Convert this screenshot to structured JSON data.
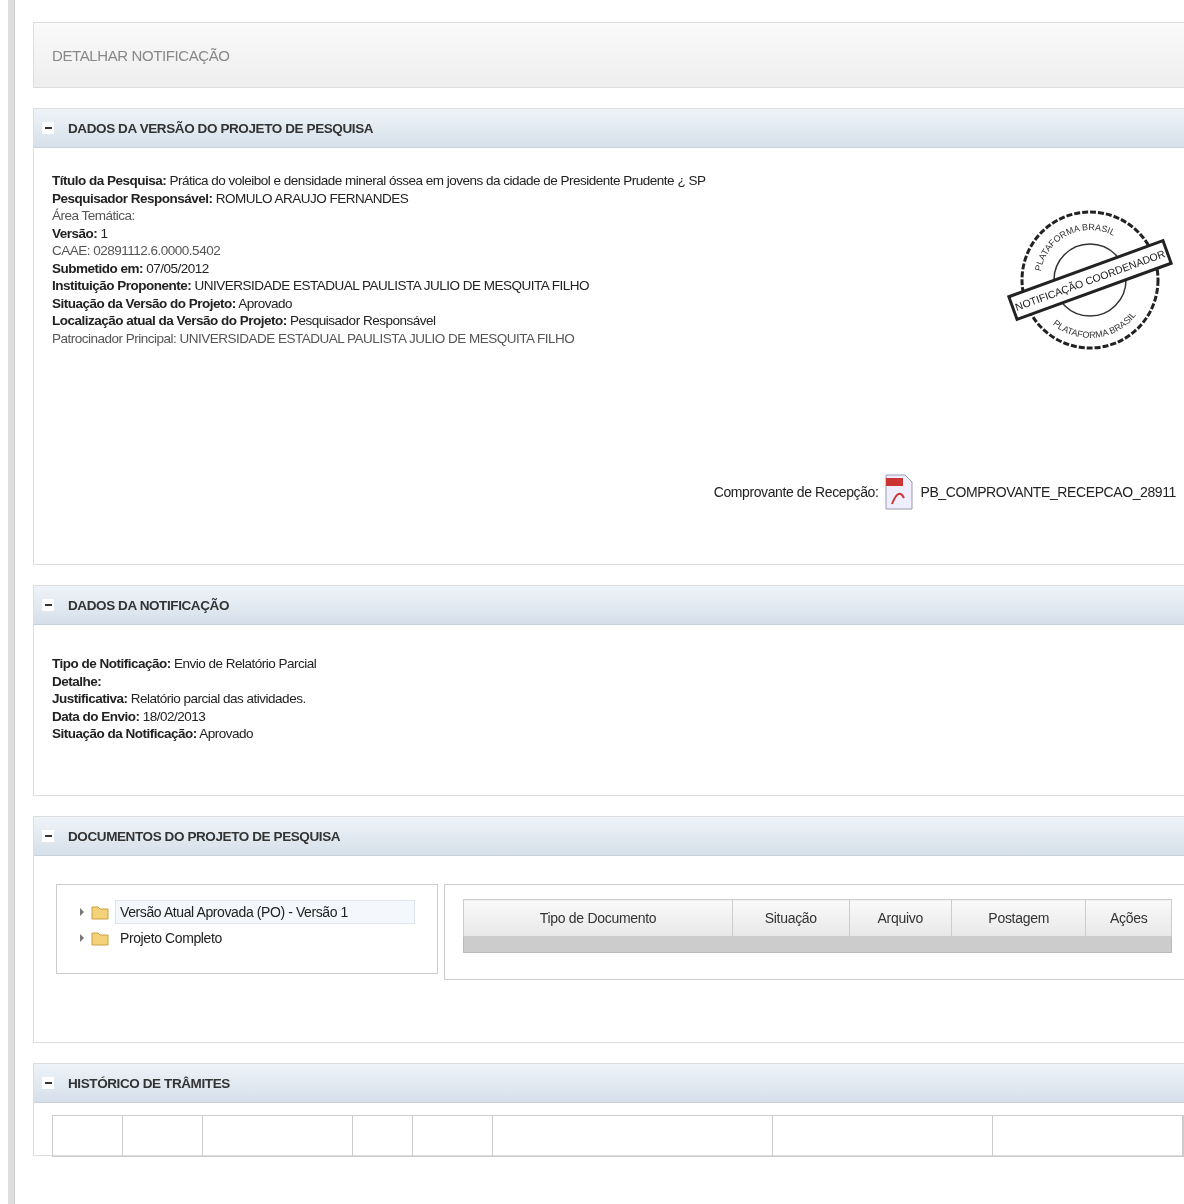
{
  "page_title": "DETALHAR NOTIFICAÇÃO",
  "project_section": {
    "title": "DADOS DA VERSÃO DO PROJETO DE PESQUISA",
    "expanded": true,
    "fields": [
      {
        "label": "Título da Pesquisa:",
        "value": "Prática do voleibol e densidade mineral óssea em jovens da cidade de Presidente Prudente ¿ SP",
        "emphasis": true
      },
      {
        "label": "Pesquisador Responsável:",
        "value": "ROMULO ARAUJO FERNANDES",
        "emphasis": true
      },
      {
        "label": "Área Temática:",
        "emphasis": false
      },
      {
        "label": "Versão:",
        "value": "1",
        "emphasis": true
      },
      {
        "label": "CAAE:",
        "value": "02891112.6.0000.5402",
        "emphasis": false
      },
      {
        "label": "Submetido em:",
        "value": "07/05/2012",
        "emphasis": true
      },
      {
        "label": "Instituição Proponente:",
        "value": "UNIVERSIDADE ESTADUAL PAULISTA JULIO DE MESQUITA FILHO",
        "emphasis": true
      },
      {
        "label": "Situação da Versão do Projeto:",
        "value": "Aprovado",
        "emphasis": true
      },
      {
        "label": "Localização atual da Versão do Projeto:",
        "value": "Pesquisador Responsável",
        "emphasis": true
      },
      {
        "label": "Patrocinador Principal:",
        "value": "UNIVERSIDADE ESTADUAL PAULISTA JULIO DE MESQUITA FILHO",
        "emphasis": false
      }
    ],
    "stamp": {
      "band": "NOTIFICAÇÃO COORDENADOR",
      "ring_top": "PLATAFORMA BRASIL",
      "ring_bottom": "PLATAFORMA BRASIL"
    },
    "receipt": {
      "label": "Comprovante de Recepção:",
      "file": "PB_COMPROVANTE_RECEPCAO_28911"
    }
  },
  "notification_section": {
    "title": "DADOS DA NOTIFICAÇÃO",
    "expanded": true,
    "fields": [
      {
        "label": "Tipo de Notificação:",
        "value": "Envio de Relatório Parcial",
        "emphasis": true
      },
      {
        "label": "Detalhe:",
        "emphasis": true
      },
      {
        "label": "Justificativa:",
        "value": "Relatório parcial das atividades.",
        "emphasis": true
      },
      {
        "label": "Data do Envio:",
        "value": "18/02/2013",
        "emphasis": true
      },
      {
        "label": "Situação da Notificação:",
        "value": "Aprovado",
        "emphasis": true
      }
    ]
  },
  "documents_section": {
    "title": "DOCUMENTOS DO PROJETO DE PESQUISA",
    "expanded": true,
    "tree": [
      {
        "label": "Versão Atual Aprovada (PO) - Versão 1",
        "selected": true,
        "expanded": false
      },
      {
        "label": "Projeto Completo",
        "selected": false,
        "expanded": false
      }
    ],
    "table": {
      "columns": [
        "Tipo de Documento",
        "Situação",
        "Arquivo",
        "Postagem",
        "Ações"
      ]
    }
  },
  "history_section": {
    "title": "HISTÓRICO DE TRÂMITES",
    "expanded": true
  }
}
